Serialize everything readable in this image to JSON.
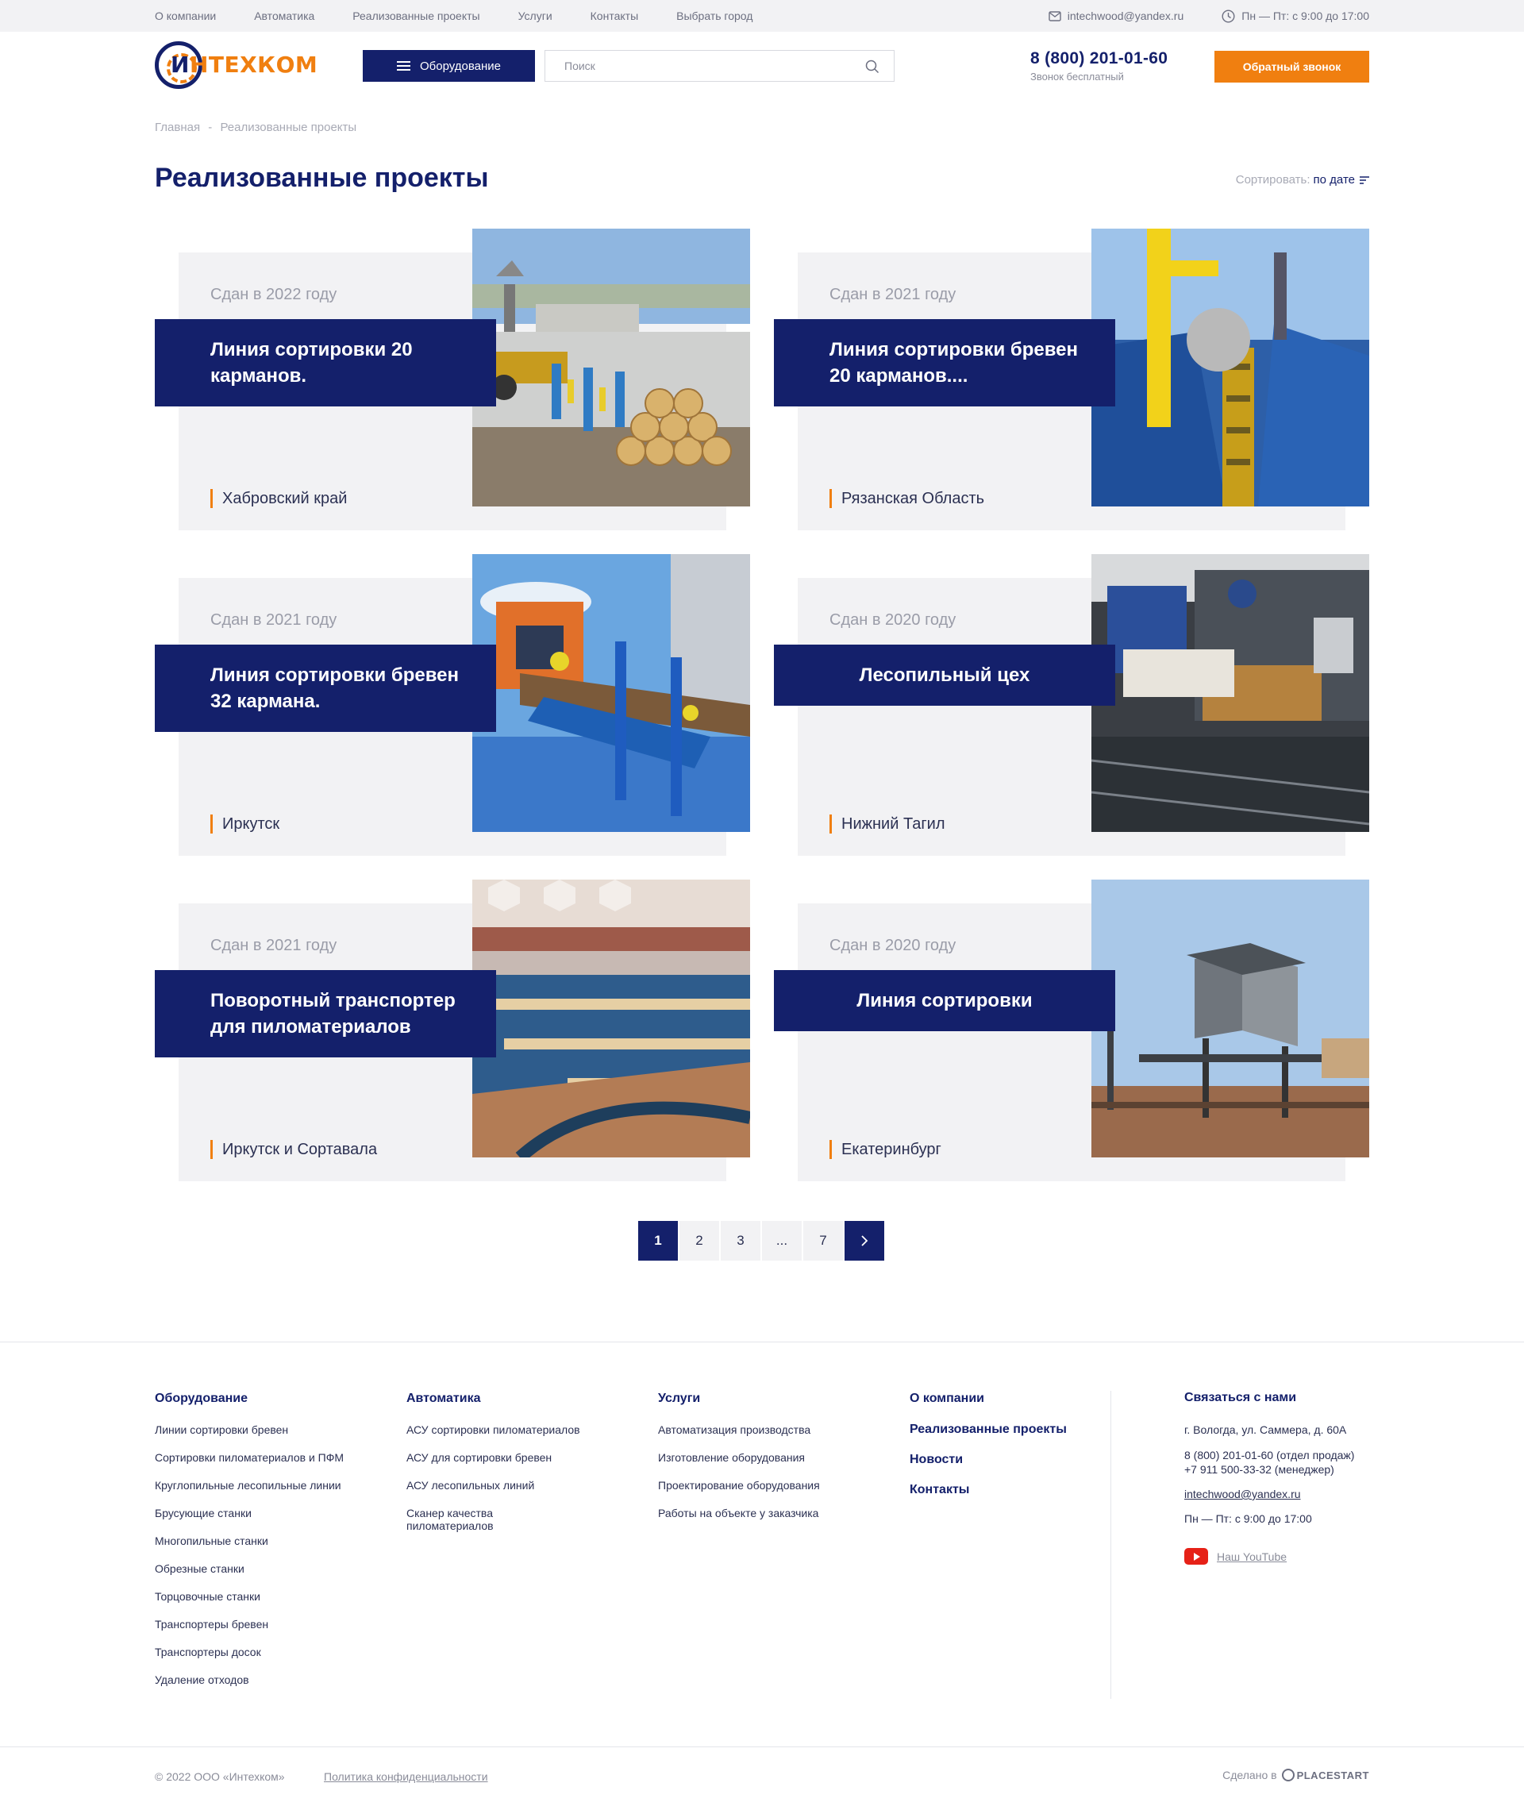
{
  "topbar": {
    "nav": [
      "О компании",
      "Автоматика",
      "Реализованные проекты",
      "Услуги",
      "Контакты",
      "Выбрать город"
    ],
    "email": "intechwood@yandex.ru",
    "hours": "Пн — Пт: с 9:00 до 17:00"
  },
  "header": {
    "logo_text": "ИНТЕХКОМ",
    "equipment_label": "Оборудование",
    "search_placeholder": "Поиск",
    "phone": "8 (800) 201-01-60",
    "phone_note": "Звонок бесплатный",
    "callback_label": "Обратный звонок"
  },
  "breadcrumb": {
    "home": "Главная",
    "separator": "-",
    "current": "Реализованные проекты"
  },
  "page_title": "Реализованные проекты",
  "sort": {
    "label": "Сортировать:",
    "value": "по дате"
  },
  "projects": [
    {
      "year": "Сдан в 2022 году",
      "title": "Линия сортировки 20 карманов.",
      "place": "Хабровский край",
      "centered": false,
      "photo": "log-sorting-yard"
    },
    {
      "year": "Сдан в 2021 году",
      "title": "Линия сортировки бревен 20 карманов....",
      "place": "Рязанская Область",
      "centered": false,
      "photo": "blue-sorting-conveyor"
    },
    {
      "year": "Сдан в 2021 году",
      "title": "Линия сортировки бревен 32 кармана.",
      "place": "Иркутск",
      "centered": false,
      "photo": "log-scanner-frame"
    },
    {
      "year": "Сдан в 2020 году",
      "title": "Лесопильный цех",
      "place": "Нижний Тагил",
      "centered": true,
      "photo": "sawmill-machinery"
    },
    {
      "year": "Сдан в 2021 году",
      "title": "Поворотный транспортер для пиломатериалов",
      "place": "Иркутск и Сортавала",
      "centered": false,
      "photo": "board-transporter"
    },
    {
      "year": "Сдан в 2020 году",
      "title": "Линия сортировки",
      "place": "Екатеринбург",
      "centered": true,
      "photo": "operator-cabin"
    }
  ],
  "pagination": {
    "pages": [
      "1",
      "2",
      "3",
      "...",
      "7"
    ],
    "current": "1",
    "next": "›"
  },
  "footer": {
    "equipment": {
      "title": "Оборудование",
      "items": [
        "Линии сортировки бревен",
        "Сортировки пиломатериалов и ПФМ",
        "Круглопильные лесопильные линии",
        "Брусующие станки",
        "Многопильные станки",
        "Обрезные станки",
        "Торцовочные станки",
        "Транспортеры бревен",
        "Транспортеры досок",
        "Удаление отходов"
      ]
    },
    "automation": {
      "title": "Автоматика",
      "items": [
        "АСУ сортировки пиломатериалов",
        "АСУ для сортировки бревен",
        "АСУ лесопильных линий",
        "Сканер качества пиломатериалов"
      ]
    },
    "services": {
      "title": "Услуги",
      "items": [
        "Автоматизация производства",
        "Изготовление оборудования",
        "Проектирование оборудования",
        "Работы на объекте у заказчика"
      ]
    },
    "about": {
      "title": "О компании",
      "items": [
        "Реализованные проекты",
        "Новости",
        "Контакты"
      ]
    },
    "contact": {
      "title": "Связаться с нами",
      "address": "г. Вологда, ул. Саммера, д. 60А",
      "phone_sales": "8 (800) 201-01-60 (отдел продаж)",
      "phone_manager": "+7 911 500-33-32 (менеджер)",
      "email": "intechwood@yandex.ru",
      "hours": "Пн — Пт: с 9:00 до 17:00",
      "youtube": "Наш YouTube"
    },
    "copyright": "© 2022 ООО «Интехком»",
    "privacy": "Политика конфиденциальности",
    "made_by": "Сделано в",
    "made_by_brand": "PLACESTART"
  }
}
